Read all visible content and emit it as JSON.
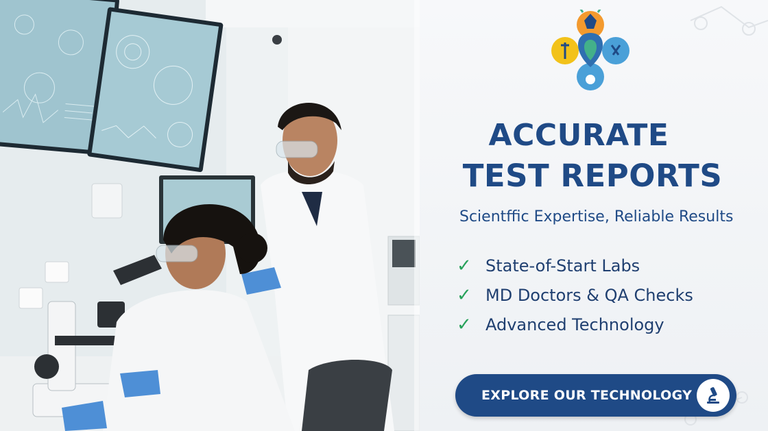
{
  "headline": {
    "line1": "ACCURATE",
    "line2": "TEST REPORTS"
  },
  "subtitle": "Scientffic Expertise, Reliable Results",
  "features": [
    {
      "icon": "check-icon",
      "label": "State-of-Start Labs"
    },
    {
      "icon": "check-icon",
      "label": "MD Doctors & QA Checks"
    },
    {
      "icon": "check-icon",
      "label": "Advanced Technology"
    }
  ],
  "cta": {
    "label": "EXPLORE OUR TECHNOLOGY",
    "icon": "microscope-icon"
  },
  "colors": {
    "brand_blue": "#1f4a86",
    "check_green": "#27a15a",
    "panel_bg": "#f4f6f8"
  },
  "photo": {
    "icon": "lab-scientists-photo"
  }
}
